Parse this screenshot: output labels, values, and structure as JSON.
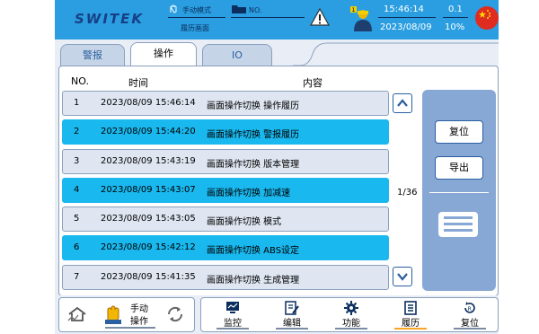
{
  "header": {
    "logo": "SWITEK",
    "mode_label": "手动模式",
    "screen_label": "履历画面",
    "file_label": "NO.",
    "time": "15:46:14",
    "date": "2023/08/09",
    "value_top": "0.1",
    "value_bottom": "10%"
  },
  "tabs": [
    {
      "label": "警报"
    },
    {
      "label": "操作"
    },
    {
      "label": "IO"
    }
  ],
  "table": {
    "col_no": "NO.",
    "col_time": "时间",
    "col_content": "内容",
    "rows": [
      {
        "no": "1",
        "time": "2023/08/09 15:46:14",
        "content": "画面操作切换 操作履历"
      },
      {
        "no": "2",
        "time": "2023/08/09 15:44:20",
        "content": "画面操作切换 警报履历"
      },
      {
        "no": "3",
        "time": "2023/08/09 15:43:19",
        "content": "画面操作切换 版本管理"
      },
      {
        "no": "4",
        "time": "2023/08/09 15:43:07",
        "content": "画面操作切换 加减速"
      },
      {
        "no": "5",
        "time": "2023/08/09 15:43:05",
        "content": "画面操作切换 模式"
      },
      {
        "no": "6",
        "time": "2023/08/09 15:42:12",
        "content": "画面操作切换 ABS设定"
      },
      {
        "no": "7",
        "time": "2023/08/09 15:41:35",
        "content": "画面操作切换 生成管理"
      }
    ]
  },
  "pager": "1/36",
  "side": {
    "reset": "复位",
    "export": "导出"
  },
  "bottom": {
    "manual_line1": "手动",
    "manual_line2": "操作",
    "monitor": "监控",
    "edit": "编辑",
    "function": "功能",
    "history": "履历",
    "reset": "复位"
  },
  "colors": {
    "header": "#2a9ee0",
    "highlight_row": "#19b8ee",
    "side_panel": "#87a8d4",
    "active_underline": "#f5a623"
  }
}
